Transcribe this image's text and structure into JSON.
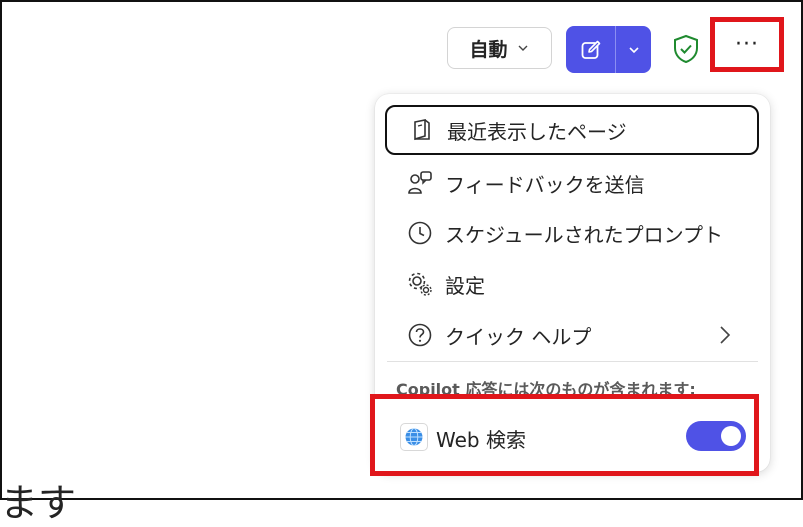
{
  "toolbar": {
    "mode_label": "自動",
    "more_label": "···"
  },
  "menu": {
    "items": [
      {
        "label": "最近表示したページ",
        "icon": "book-icon"
      },
      {
        "label": "フィードバックを送信",
        "icon": "feedback-icon"
      },
      {
        "label": "スケジュールされたプロンプト",
        "icon": "clock-icon"
      },
      {
        "label": "設定",
        "icon": "gear-icon"
      },
      {
        "label": "クイック ヘルプ",
        "icon": "help-icon"
      }
    ],
    "section_label": "Copilot 応答には次のものが含まれます:",
    "web_search": {
      "label": "Web 検索",
      "enabled": true
    }
  },
  "background": {
    "text": "ます"
  },
  "colors": {
    "accent": "#4f52e6",
    "highlight": "#e0161b",
    "shield": "#1f8a2f"
  }
}
